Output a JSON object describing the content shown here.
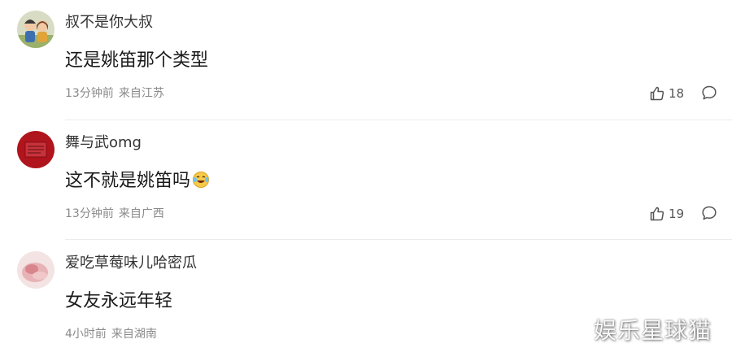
{
  "comments": [
    {
      "username": "叔不是你大叔",
      "content": "还是姚笛那个类型",
      "time": "13分钟前",
      "location": "来自江苏",
      "likes": "18",
      "avatar_icon": "cartoon-couple-avatar"
    },
    {
      "username": "舞与武omg",
      "content": "这不就是姚笛吗",
      "content_emoji": "laughing-tears-emoji",
      "time": "13分钟前",
      "location": "来自广西",
      "likes": "19",
      "avatar_icon": "red-seal-avatar"
    },
    {
      "username": "爱吃草莓味儿哈密瓜",
      "content": "女友永远年轻",
      "time": "4小时前",
      "location": "来自湖南",
      "avatar_icon": "pink-hand-avatar"
    }
  ],
  "icons": {
    "like": "thumbs-up-icon",
    "reply": "comment-bubble-icon"
  },
  "watermark": "娱乐星球猫"
}
